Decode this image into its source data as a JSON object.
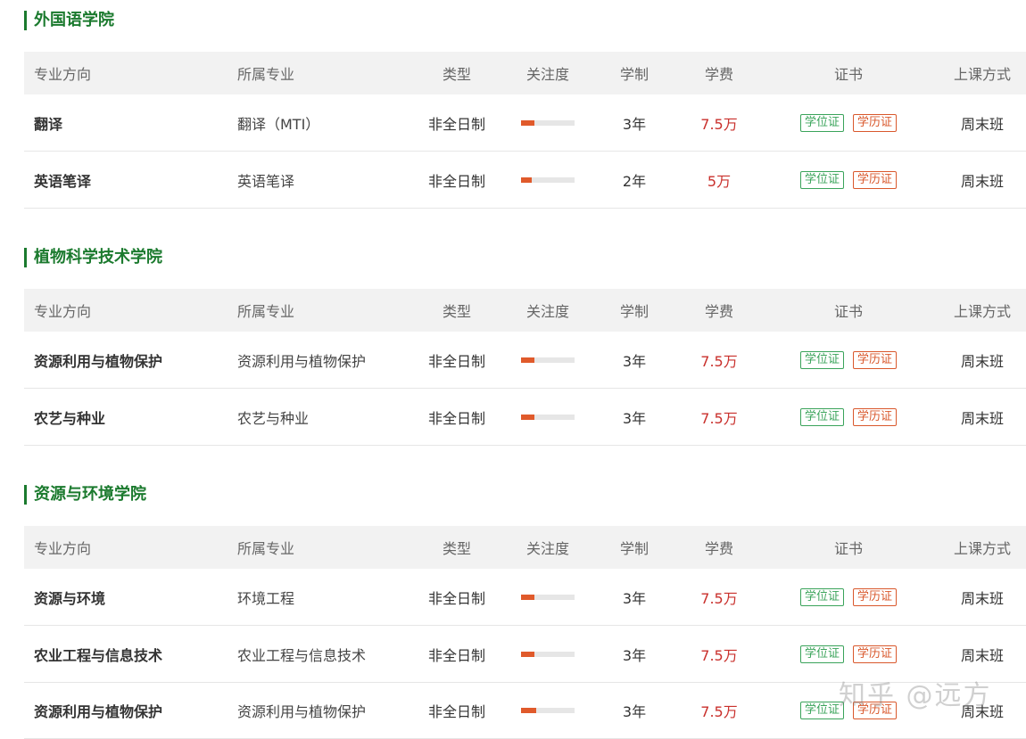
{
  "headers": {
    "direction": "专业方向",
    "major": "所属专业",
    "type": "类型",
    "attention": "关注度",
    "length": "学制",
    "fee": "学费",
    "certificate": "证书",
    "mode": "上课方式"
  },
  "badges": {
    "degree": "学位证",
    "diploma": "学历证"
  },
  "colors": {
    "title_green": "#1b7a2e",
    "fee_red": "#c9302c",
    "bar_orange": "#e05a2b",
    "badge_green": "#3aa35a",
    "badge_red": "#d9582c"
  },
  "sections": [
    {
      "title": "外国语学院",
      "rows": [
        {
          "direction": "翻译",
          "major": "翻译（MTI）",
          "type": "非全日制",
          "attention": 0.25,
          "length": "3年",
          "fee": "7.5万",
          "mode": "周末班"
        },
        {
          "direction": "英语笔译",
          "major": "英语笔译",
          "type": "非全日制",
          "attention": 0.2,
          "length": "2年",
          "fee": "5万",
          "mode": "周末班"
        }
      ]
    },
    {
      "title": "植物科学技术学院",
      "rows": [
        {
          "direction": "资源利用与植物保护",
          "major": "资源利用与植物保护",
          "type": "非全日制",
          "attention": 0.25,
          "length": "3年",
          "fee": "7.5万",
          "mode": "周末班"
        },
        {
          "direction": "农艺与种业",
          "major": "农艺与种业",
          "type": "非全日制",
          "attention": 0.25,
          "length": "3年",
          "fee": "7.5万",
          "mode": "周末班"
        }
      ]
    },
    {
      "title": "资源与环境学院",
      "rows": [
        {
          "direction": "资源与环境",
          "major": "环境工程",
          "type": "非全日制",
          "attention": 0.25,
          "length": "3年",
          "fee": "7.5万",
          "mode": "周末班"
        },
        {
          "direction": "农业工程与信息技术",
          "major": "农业工程与信息技术",
          "type": "非全日制",
          "attention": 0.25,
          "length": "3年",
          "fee": "7.5万",
          "mode": "周末班"
        },
        {
          "direction": "资源利用与植物保护",
          "major": "资源利用与植物保护",
          "type": "非全日制",
          "attention": 0.28,
          "length": "3年",
          "fee": "7.5万",
          "mode": "周末班"
        }
      ]
    }
  ],
  "watermark": "知乎 @远方"
}
